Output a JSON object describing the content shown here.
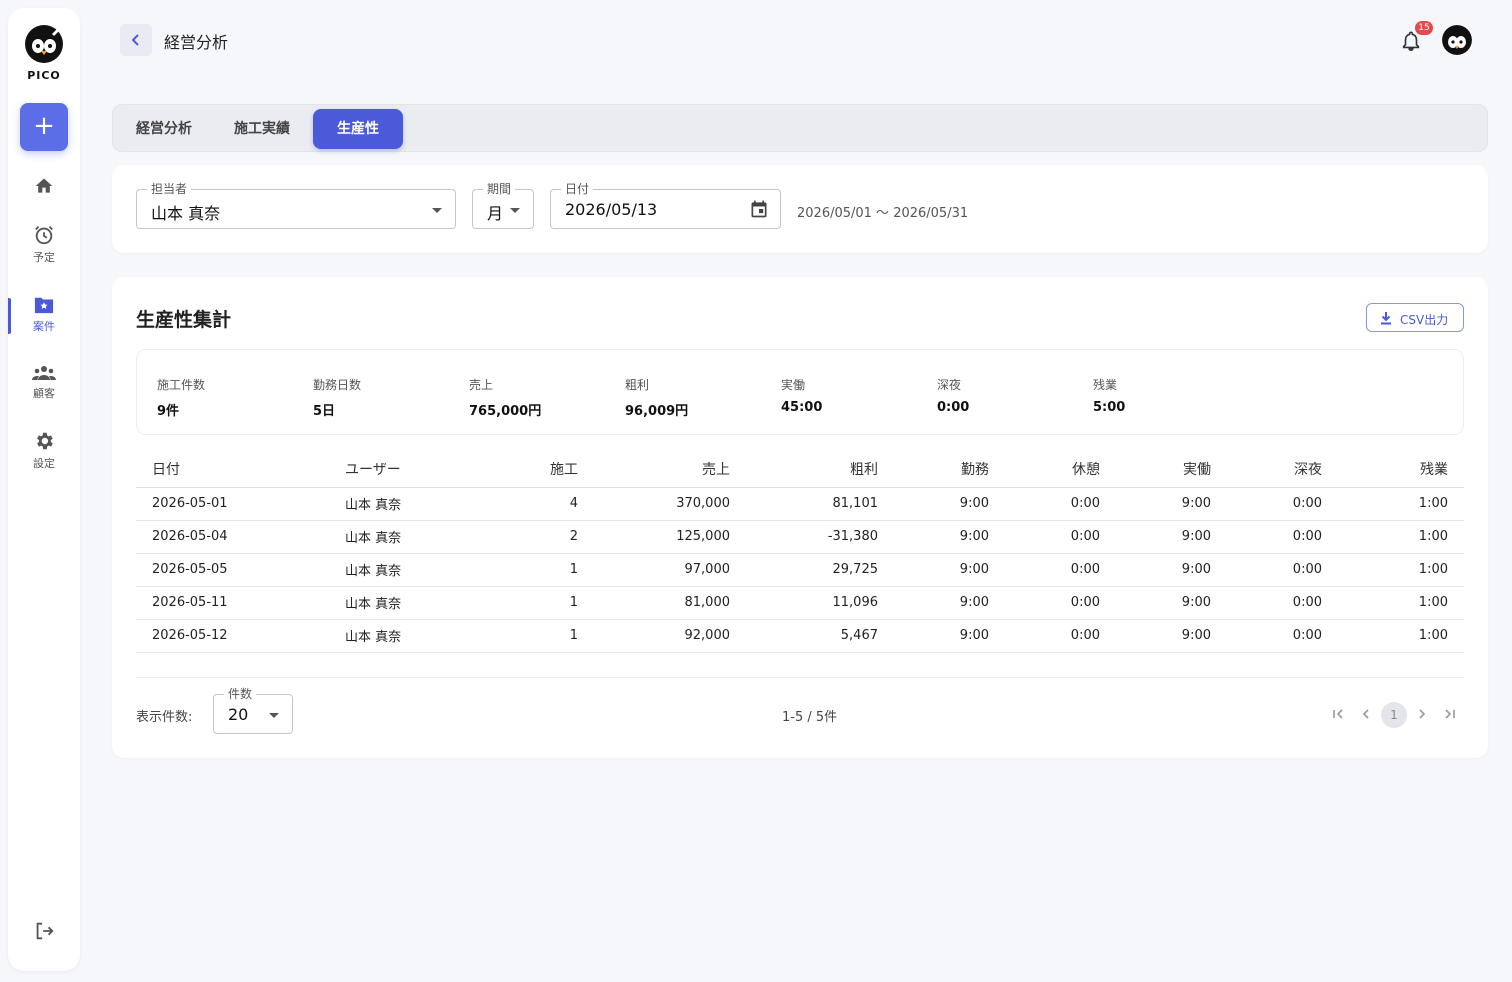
{
  "sidebar": {
    "logo_text": "PICO",
    "add_label": "+",
    "items": [
      {
        "label": ""
      },
      {
        "label": "予定"
      },
      {
        "label": "案件"
      },
      {
        "label": "顧客"
      },
      {
        "label": "設定"
      }
    ]
  },
  "header": {
    "title": "経営分析",
    "notification_count": "15"
  },
  "tabs": [
    {
      "label": "経営分析"
    },
    {
      "label": "施工実績"
    },
    {
      "label": "生産性"
    }
  ],
  "filters": {
    "assignee": {
      "label": "担当者",
      "value": "山本 真奈"
    },
    "period": {
      "label": "期間",
      "value": "月"
    },
    "date": {
      "label": "日付",
      "value": "2026/05/13"
    },
    "range_text": "2026/05/01 〜 2026/05/31"
  },
  "summary": {
    "title": "生産性集計",
    "csv_label": "CSV出力",
    "stats": [
      {
        "label": "施工件数",
        "value": "9件"
      },
      {
        "label": "勤務日数",
        "value": "5日"
      },
      {
        "label": "売上",
        "value": "765,000円"
      },
      {
        "label": "粗利",
        "value": "96,009円"
      },
      {
        "label": "実働",
        "value": "45:00"
      },
      {
        "label": "深夜",
        "value": "0:00"
      },
      {
        "label": "残業",
        "value": "5:00"
      }
    ]
  },
  "table": {
    "headers": [
      "日付",
      "ユーザー",
      "施工",
      "売上",
      "粗利",
      "勤務",
      "休憩",
      "実働",
      "深夜",
      "残業"
    ],
    "rows": [
      [
        "2026-05-01",
        "山本 真奈",
        "4",
        "370,000",
        "81,101",
        "9:00",
        "0:00",
        "9:00",
        "0:00",
        "1:00"
      ],
      [
        "2026-05-04",
        "山本 真奈",
        "2",
        "125,000",
        "-31,380",
        "9:00",
        "0:00",
        "9:00",
        "0:00",
        "1:00"
      ],
      [
        "2026-05-05",
        "山本 真奈",
        "1",
        "97,000",
        "29,725",
        "9:00",
        "0:00",
        "9:00",
        "0:00",
        "1:00"
      ],
      [
        "2026-05-11",
        "山本 真奈",
        "1",
        "81,000",
        "11,096",
        "9:00",
        "0:00",
        "9:00",
        "0:00",
        "1:00"
      ],
      [
        "2026-05-12",
        "山本 真奈",
        "1",
        "92,000",
        "5,467",
        "9:00",
        "0:00",
        "9:00",
        "0:00",
        "1:00"
      ]
    ]
  },
  "pagination": {
    "per_page_label": "表示件数:",
    "per_page_field_label": "件数",
    "per_page_value": "20",
    "info": "1-5 / 5件",
    "current_page": "1"
  },
  "colors": {
    "accent": "#4b5ad8",
    "badge": "#e5484d"
  }
}
